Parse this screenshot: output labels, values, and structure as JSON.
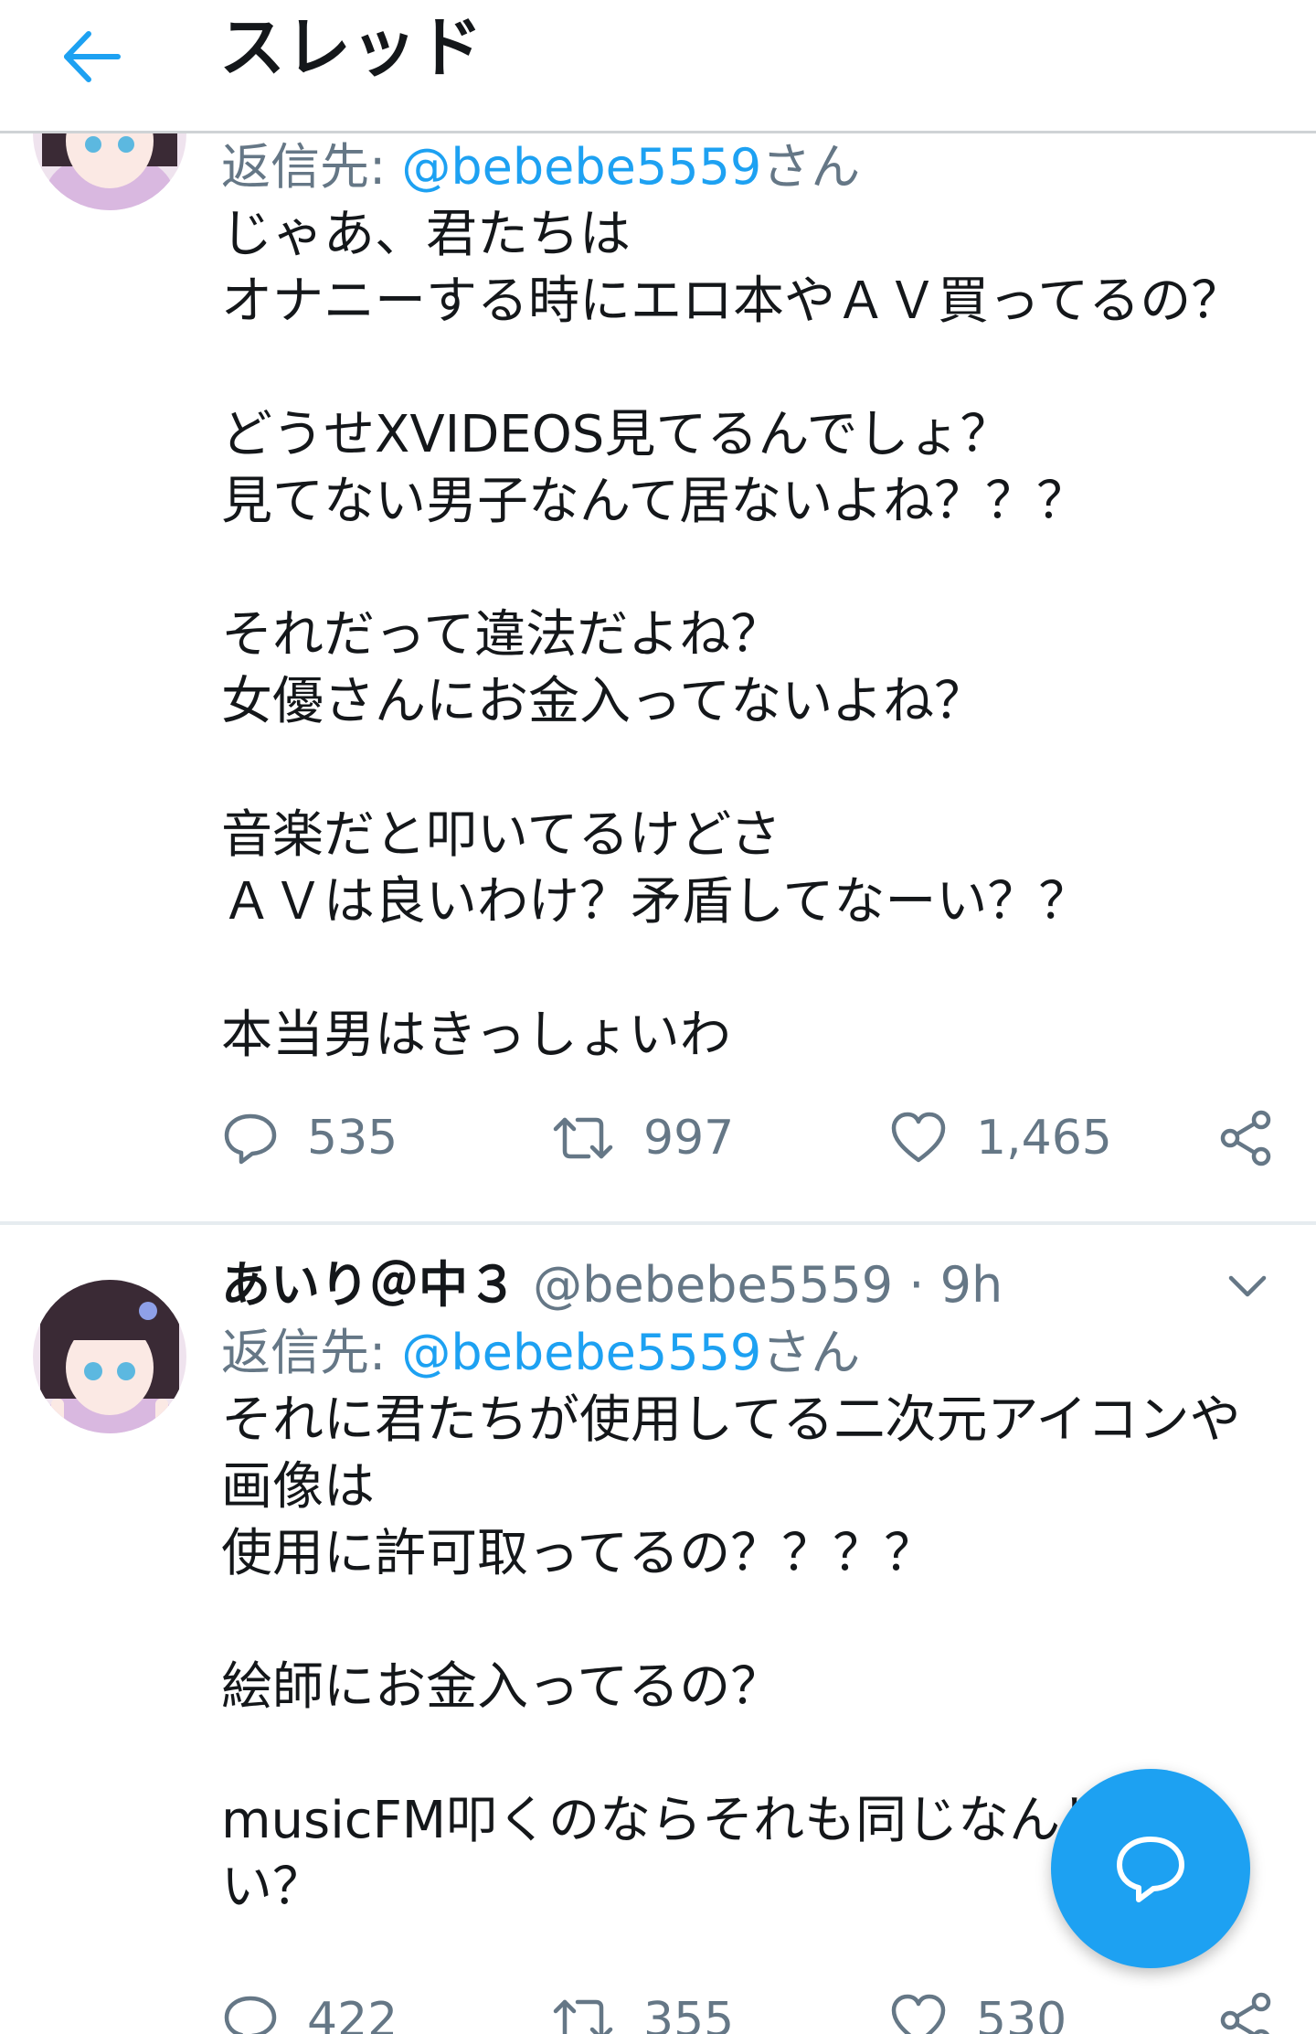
{
  "header": {
    "title": "スレッド"
  },
  "tweets": [
    {
      "reply_prefix": "返信先: ",
      "reply_mention": "@bebebe5559",
      "reply_suffix": "さん",
      "lines": [
        "じゃあ、君たちは",
        "オナニーする時にエロ本やＡＶ買ってるの？",
        "",
        "どうせXVIDEOS見てるんでしょ？",
        "見てない男子なんて居ないよね？？？",
        "",
        "それだって違法だよね？",
        "女優さんにお金入ってないよね？",
        "",
        "音楽だと叩いてるけどさ",
        "ＡＶは良いわけ？矛盾してなーい？？",
        "",
        "本当男はきっしょいわ"
      ],
      "replies": "535",
      "retweets": "997",
      "likes": "1,465"
    },
    {
      "name": "あいり＠中３",
      "handle": "@bebebe5559",
      "dot": "·",
      "time": "9h",
      "reply_prefix": "返信先: ",
      "reply_mention": "@bebebe5559",
      "reply_suffix": "さん",
      "lines": [
        "それに君たちが使用してる二次元アイコンや",
        "画像は",
        "使用に許可取ってるの？？？？",
        "",
        "絵師にお金入ってるの？",
        "",
        "musicFM叩くのならそれも同じなんじゃな",
        "い？"
      ],
      "replies": "422",
      "retweets": "355",
      "likes": "530"
    }
  ],
  "icons": {
    "back": "arrow-left-icon",
    "reply": "speech-bubble-icon",
    "retweet": "retweet-icon",
    "like": "heart-icon",
    "share": "share-icon",
    "caret": "chevron-down-icon",
    "compose": "compose-reply-icon"
  },
  "colors": {
    "accent": "#1da1f2",
    "muted": "#657786",
    "text": "#14171a"
  }
}
